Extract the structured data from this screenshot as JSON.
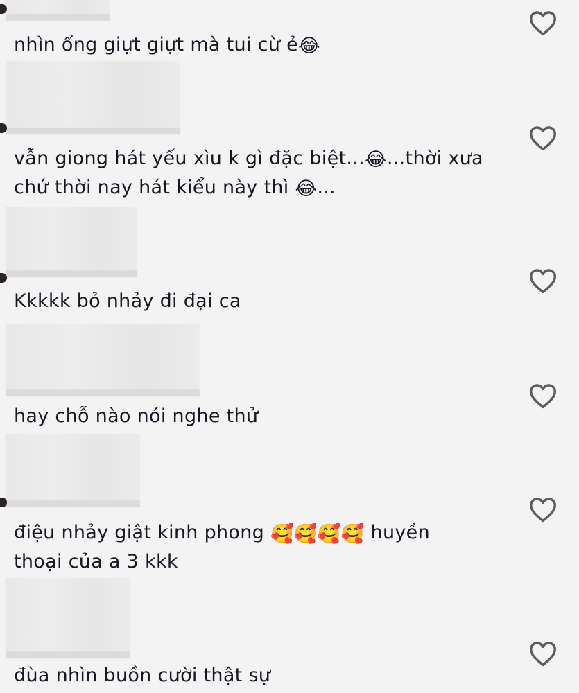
{
  "comments": [
    {
      "text": "nhìn ổng giựt giựt mà tui cừ ẻ",
      "emoji_after": "😂",
      "emoji_name": "tears-of-joy-emoji"
    },
    {
      "text_a": "vẫn giong hát yếu xìu k gì đặc biệt...",
      "emoji_mid": "😂",
      "text_b": "...thời xưa",
      "text_c": "chứ thời nay hát kiểu này thì ",
      "emoji_end": "😂",
      "text_d": "..."
    },
    {
      "text": "Kkkkk bỏ nhảy đi đại ca"
    },
    {
      "text": "hay chỗ nào nói nghe thử"
    },
    {
      "text_a": "điệu nhảy giật kinh phong ",
      "emojis": "🥰🥰🥰🥰",
      "text_b": " huyền",
      "text_c": "thoại của a 3 kkk"
    },
    {
      "text": "đùa nhìn buồn cười thật sự"
    }
  ],
  "icons": {
    "like": "heart-outline-icon"
  },
  "colors": {
    "background": "#f4f3f3",
    "text": "#161823",
    "heart": "#5c5c60"
  }
}
